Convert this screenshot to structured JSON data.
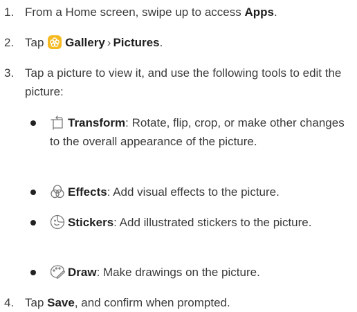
{
  "steps": [
    {
      "number": "1.",
      "prefix": "From a Home screen, swipe up to access ",
      "bold": "Apps",
      "suffix": "."
    },
    {
      "number": "2.",
      "prefix": "Tap ",
      "icon": "gallery-icon",
      "bold1": "Gallery",
      "separator": "›",
      "bold2": "Pictures",
      "suffix": "."
    },
    {
      "number": "3.",
      "text": "Tap a picture to view it, and use the following tools to edit the picture:"
    },
    {
      "number": "4.",
      "prefix": "Tap ",
      "bold": "Save",
      "suffix": ", and confirm when prompted."
    }
  ],
  "tools": [
    {
      "icon": "transform-icon",
      "name": "Transform",
      "description": ": Rotate, flip, crop, or make other changes to the overall appearance of the picture."
    },
    {
      "icon": "effects-icon",
      "name": "Effects",
      "description": ": Add visual effects to the picture."
    },
    {
      "icon": "stickers-icon",
      "name": "Stickers",
      "description": ": Add illustrated stickers to the picture."
    },
    {
      "icon": "draw-icon",
      "name": "Draw",
      "description": ": Make drawings on the picture."
    }
  ],
  "colors": {
    "gallery_icon_bg": "#f5b921",
    "icon_stroke": "#7a7a7a",
    "text": "#3a3a3a"
  }
}
